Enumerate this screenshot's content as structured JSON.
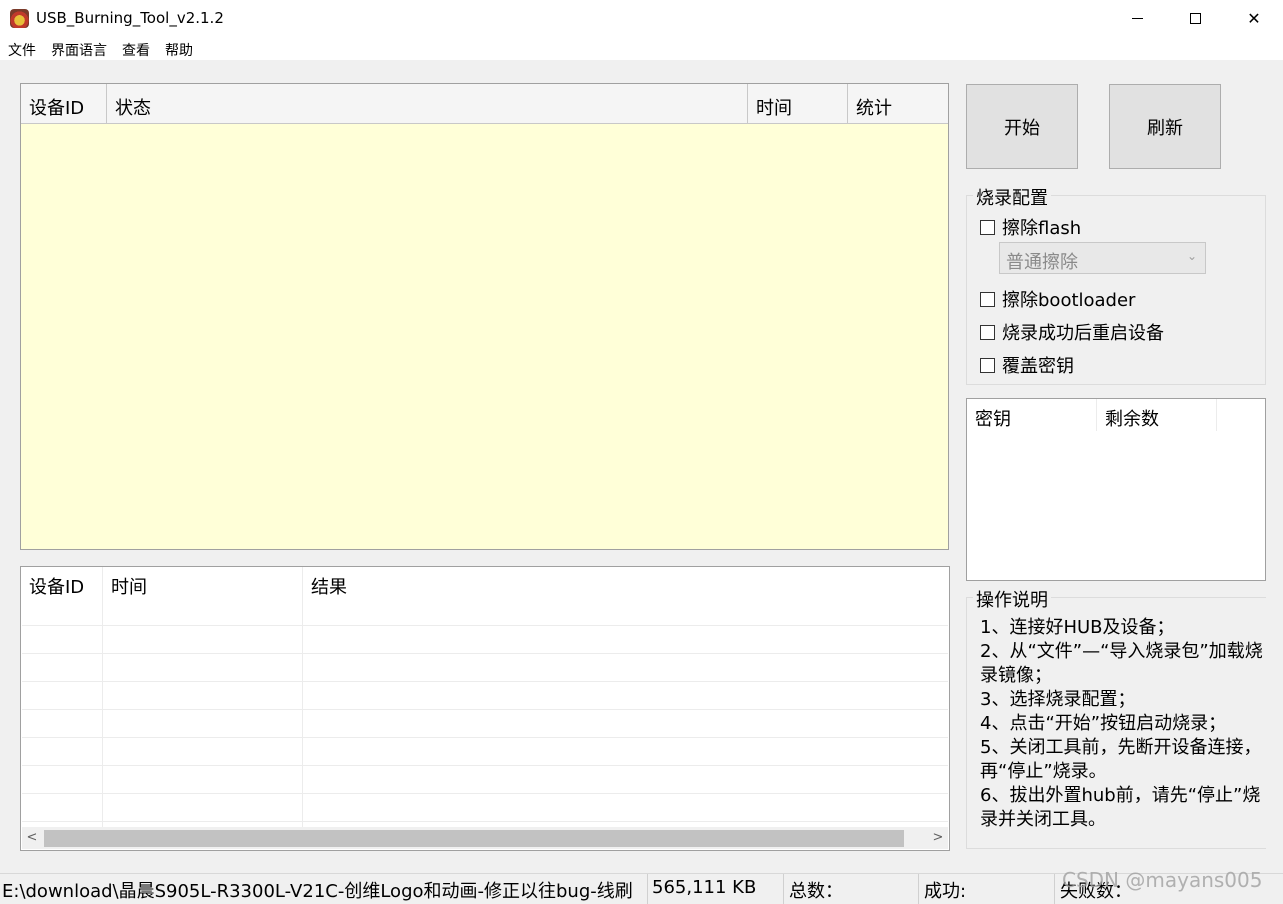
{
  "window": {
    "title": "USB_Burning_Tool_v2.1.2"
  },
  "menu": [
    "文件",
    "界面语言",
    "查看",
    "帮助"
  ],
  "device_table": {
    "columns": [
      "设备ID",
      "状态",
      "时间",
      "统计"
    ]
  },
  "result_table": {
    "columns": [
      "设备ID",
      "时间",
      "结果"
    ]
  },
  "buttons": {
    "start": "开始",
    "refresh": "刷新"
  },
  "burn_config": {
    "title": "烧录配置",
    "erase_flash": "擦除flash",
    "erase_mode": "普通擦除",
    "erase_bootloader": "擦除bootloader",
    "reboot_after": "烧录成功后重启设备",
    "overwrite_key": "覆盖密钥"
  },
  "key_table": {
    "columns": [
      "密钥",
      "剩余数"
    ]
  },
  "instructions": {
    "title": "操作说明",
    "lines": [
      "1、连接好HUB及设备；",
      "2、从“文件”—“导入烧录包”加载烧录镜像；",
      "3、选择烧录配置；",
      "4、点击“开始”按钮启动烧录；",
      "5、关闭工具前，先断开设备连接，再“停止”烧录。",
      "6、拔出外置hub前，请先“停止”烧录并关闭工具。"
    ]
  },
  "statusbar": {
    "path": "E:\\download\\晶晨S905L-R3300L-V21C-创维Logo和动画-修正以往bug-线刷",
    "size": "565,111 KB",
    "total": "总数：",
    "success": "成功:",
    "fail": "失败数："
  },
  "watermark": "CSDN @mayans005"
}
